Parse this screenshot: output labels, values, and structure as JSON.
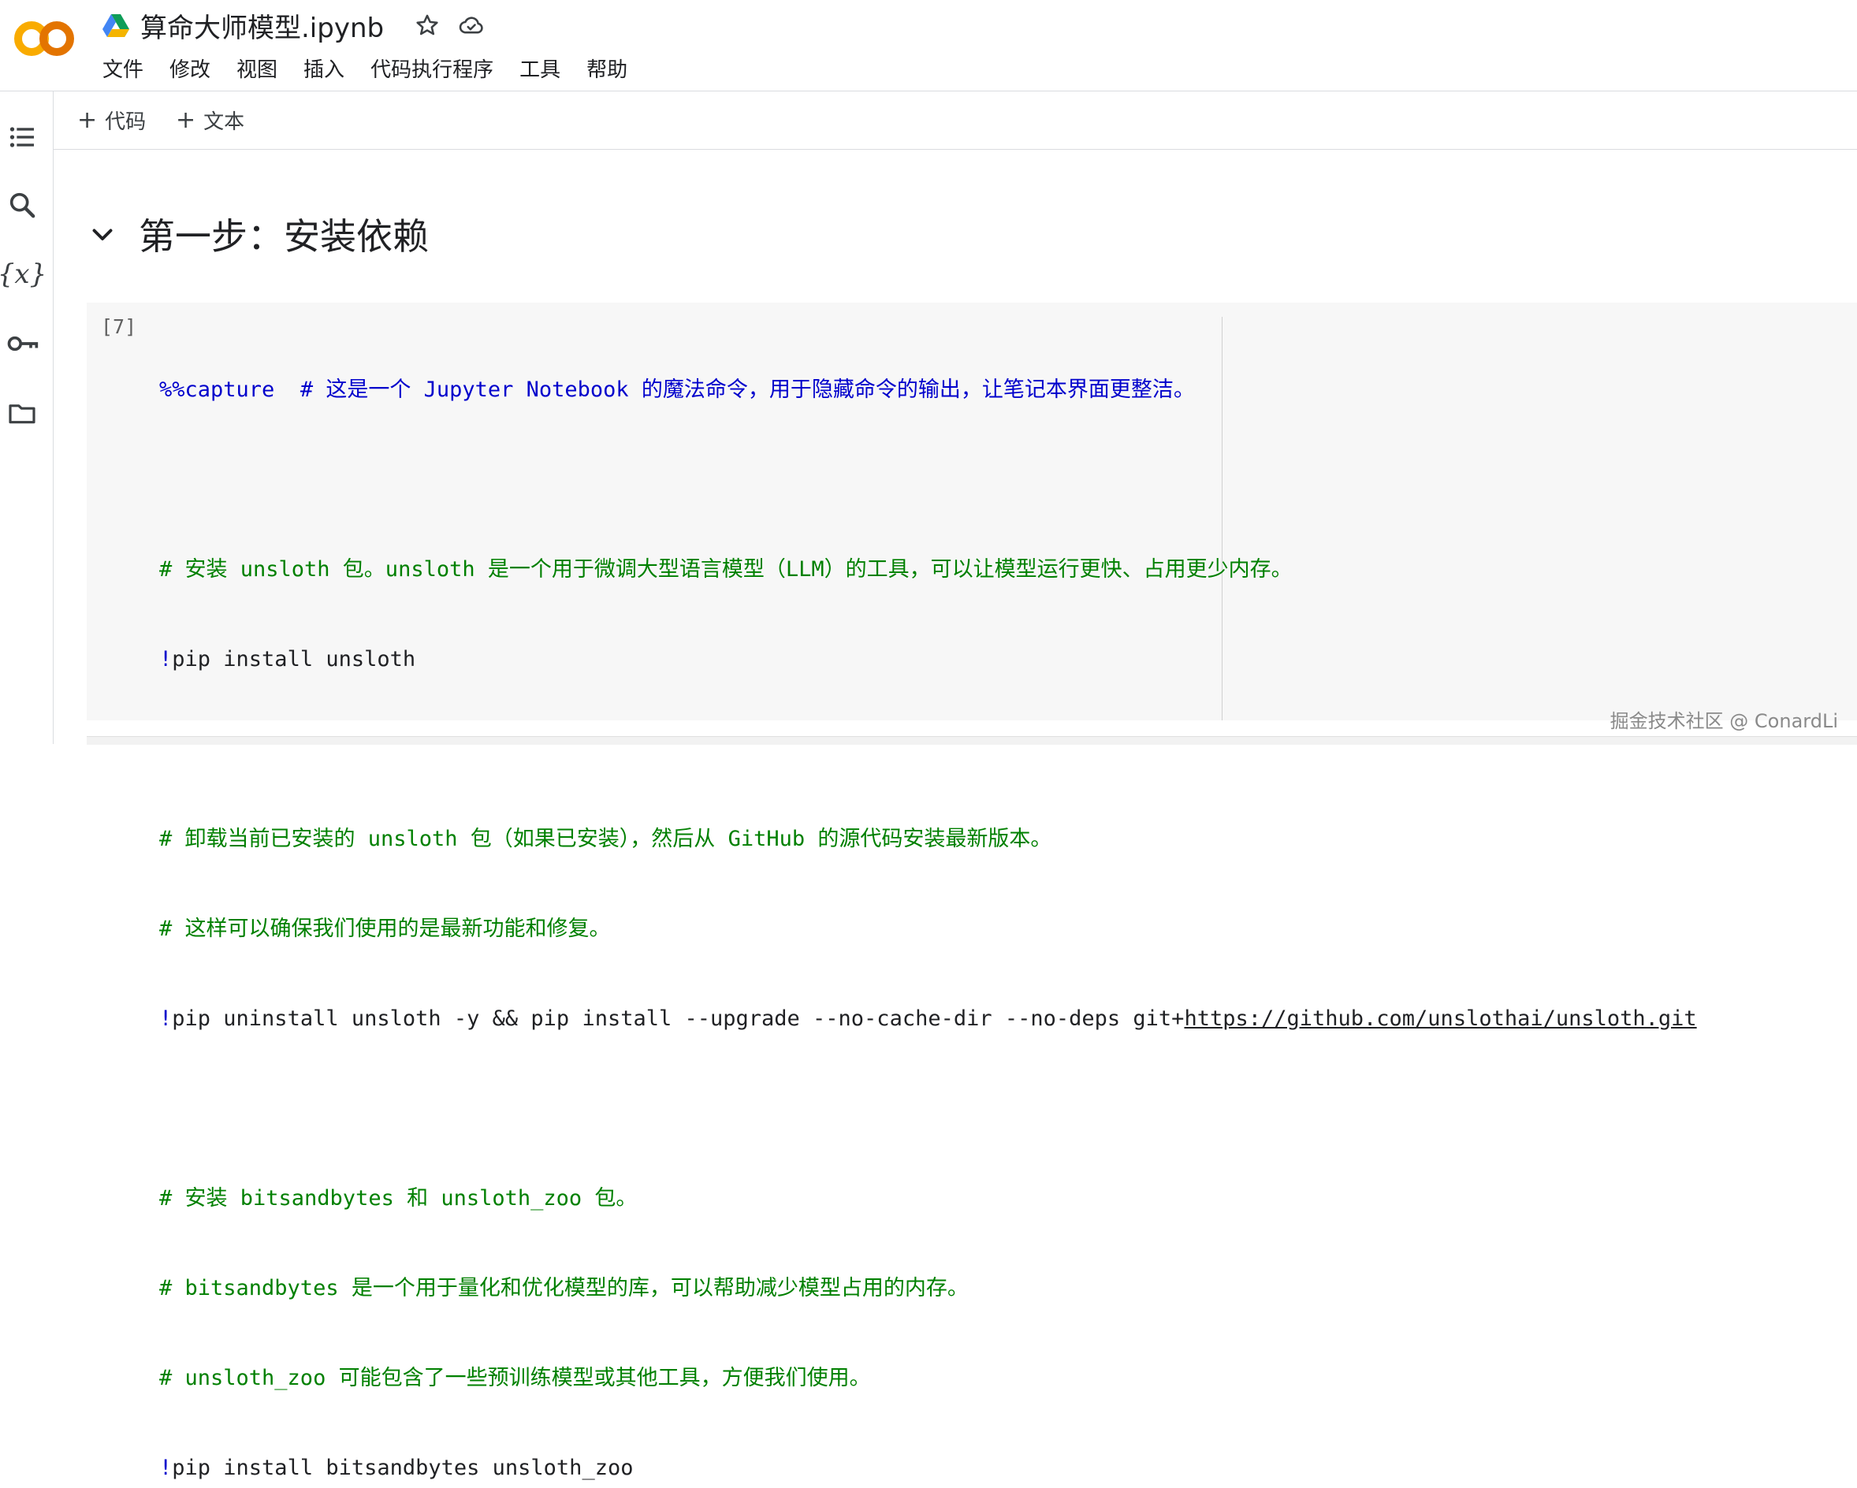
{
  "header": {
    "logo": "CO",
    "doc_title": "算命大师模型.ipynb",
    "icons": [
      "google-drive-icon",
      "star-icon",
      "cloud-check-icon"
    ]
  },
  "menu": {
    "items": [
      "文件",
      "修改",
      "视图",
      "插入",
      "代码执行程序",
      "工具",
      "帮助"
    ]
  },
  "sidebar": {
    "icons": [
      "table-of-contents-icon",
      "search-icon",
      "variables-icon",
      "key-icon",
      "folder-icon"
    ],
    "variables_glyph": "{x}"
  },
  "toolbar": {
    "add_code_label": "代码",
    "add_text_label": "文本",
    "plus": "+"
  },
  "section": {
    "heading": "第一步：安装依赖"
  },
  "cell": {
    "execution_count": "[7]",
    "lines": {
      "l1_magic": "%%capture",
      "l1_comment": "  # 这是一个 Jupyter Notebook 的魔法命令，用于隐藏命令的输出，让笔记本界面更整洁。",
      "l3_comment": "# 安装 unsloth 包。unsloth 是一个用于微调大型语言模型（LLM）的工具，可以让模型运行更快、占用更少内存。",
      "l4_bang": "!",
      "l4_cmd": "pip install unsloth",
      "l6_comment": "# 卸载当前已安装的 unsloth 包（如果已安装），然后从 GitHub 的源代码安装最新版本。",
      "l7_comment": "# 这样可以确保我们使用的是最新功能和修复。",
      "l8_bang": "!",
      "l8_cmd": "pip uninstall unsloth -y && pip install --upgrade --no-cache-dir --no-deps git+",
      "l8_url": "https://github.com/unslothai/unsloth.git",
      "l10_comment": "# 安装 bitsandbytes 和 unsloth_zoo 包。",
      "l11_comment": "# bitsandbytes 是一个用于量化和优化模型的库，可以帮助减少模型占用的内存。",
      "l12_comment": "# unsloth_zoo 可能包含了一些预训练模型或其他工具，方便我们使用。",
      "l13_bang": "!",
      "l13_cmd": "pip install bitsandbytes unsloth_zoo"
    }
  },
  "watermark": "掘金技术社区 @ ConardLi",
  "colors": {
    "logo_orange": "#f9ab00",
    "logo_orange_dark": "#e37400",
    "comment_green": "#008000",
    "magic_blue": "#0000cc",
    "cell_bg": "#f7f7f7"
  }
}
